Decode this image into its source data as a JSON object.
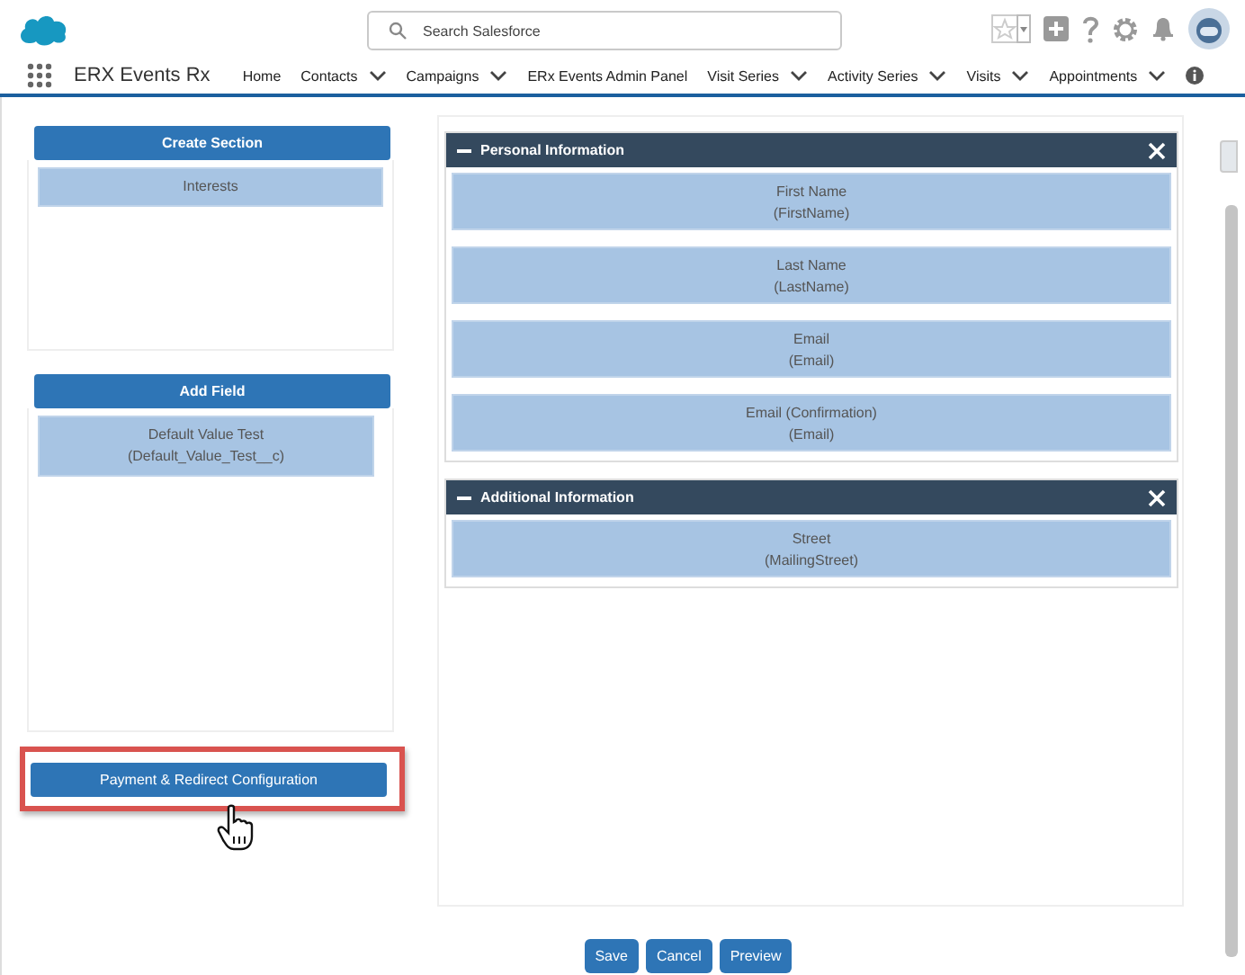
{
  "header": {
    "search": {
      "placeholder": "Search Salesforce"
    }
  },
  "nav": {
    "app_name": "ERX Events Rx",
    "items": [
      {
        "label": "Home",
        "has_menu": false
      },
      {
        "label": "Contacts",
        "has_menu": true
      },
      {
        "label": "Campaigns",
        "has_menu": true
      },
      {
        "label": "ERx Events Admin Panel",
        "has_menu": false
      },
      {
        "label": "Visit Series",
        "has_menu": true
      },
      {
        "label": "Activity Series",
        "has_menu": true
      },
      {
        "label": "Visits",
        "has_menu": true
      },
      {
        "label": "Appointments",
        "has_menu": true
      }
    ]
  },
  "left": [
    {
      "button": "Create Section",
      "items": [
        {
          "label": "Interests"
        }
      ]
    },
    {
      "button": "Add Field",
      "items": [
        {
          "label": "Default Value Test",
          "api_name": "(Default_Value_Test__c)"
        }
      ]
    }
  ],
  "config_button": {
    "label": "Payment & Redirect Configuration",
    "highlighted": true
  },
  "sections": [
    {
      "title": "Personal Information",
      "fields": [
        {
          "label": "First Name",
          "api_name": "(FirstName)"
        },
        {
          "label": "Last Name",
          "api_name": "(LastName)"
        },
        {
          "label": "Email",
          "api_name": "(Email)"
        },
        {
          "label": "Email (Confirmation)",
          "api_name": "(Email)"
        }
      ]
    },
    {
      "title": "Additional Information",
      "fields": [
        {
          "label": "Street",
          "api_name": "(MailingStreet)"
        }
      ]
    }
  ],
  "footer_buttons": [
    "Save",
    "Cancel",
    "Preview"
  ]
}
